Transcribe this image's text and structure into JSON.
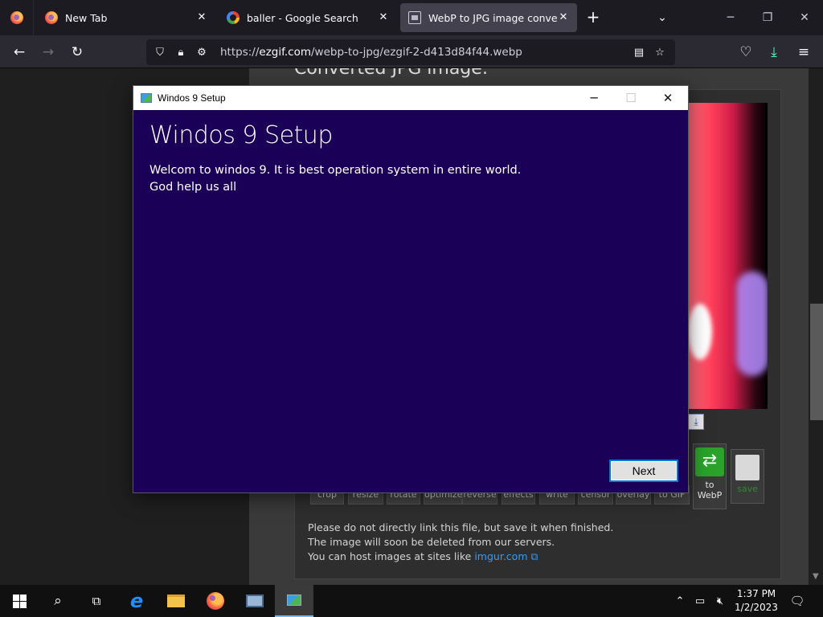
{
  "browser": {
    "tabs": [
      {
        "title": "New Tab",
        "icon": "firefox-icon",
        "active": false
      },
      {
        "title": "baller - Google Search",
        "icon": "google-icon",
        "active": false
      },
      {
        "title": "WebP to JPG image converter -",
        "icon": "ezgif-icon",
        "active": true
      }
    ],
    "url_prefix": "https://",
    "url_domain": "ezgif.com",
    "url_path": "/webp-to-jpg/ezgif-2-d413d84f44.webp"
  },
  "page": {
    "heading_partial": "Converted JPG image:",
    "tool_buttons": [
      "crop",
      "resize",
      "rotate",
      "optimize",
      "reverse",
      "effects",
      "write",
      "censor",
      "overlay",
      "to GIF"
    ],
    "to_webp_label_1": "to",
    "to_webp_label_2": "WebP",
    "save_label": "save",
    "notice_line1": "Please do not directly link this file, but save it when finished.",
    "notice_line2": "The image will soon be deleted from our servers.",
    "notice_line3_prefix": "You can host images at sites like ",
    "notice_link": "imgur.com"
  },
  "dialog": {
    "window_title": "Windos 9 Setup",
    "heading": "Windos 9 Setup",
    "line1": "Welcom to windos 9. It is best operation system in entire world.",
    "line2": "God help us all",
    "next_label": "Next"
  },
  "taskbar": {
    "time": "1:37 PM",
    "date": "1/2/2023"
  },
  "colors": {
    "dialog_bg": "#1b0057",
    "accent": "#0078d7"
  }
}
